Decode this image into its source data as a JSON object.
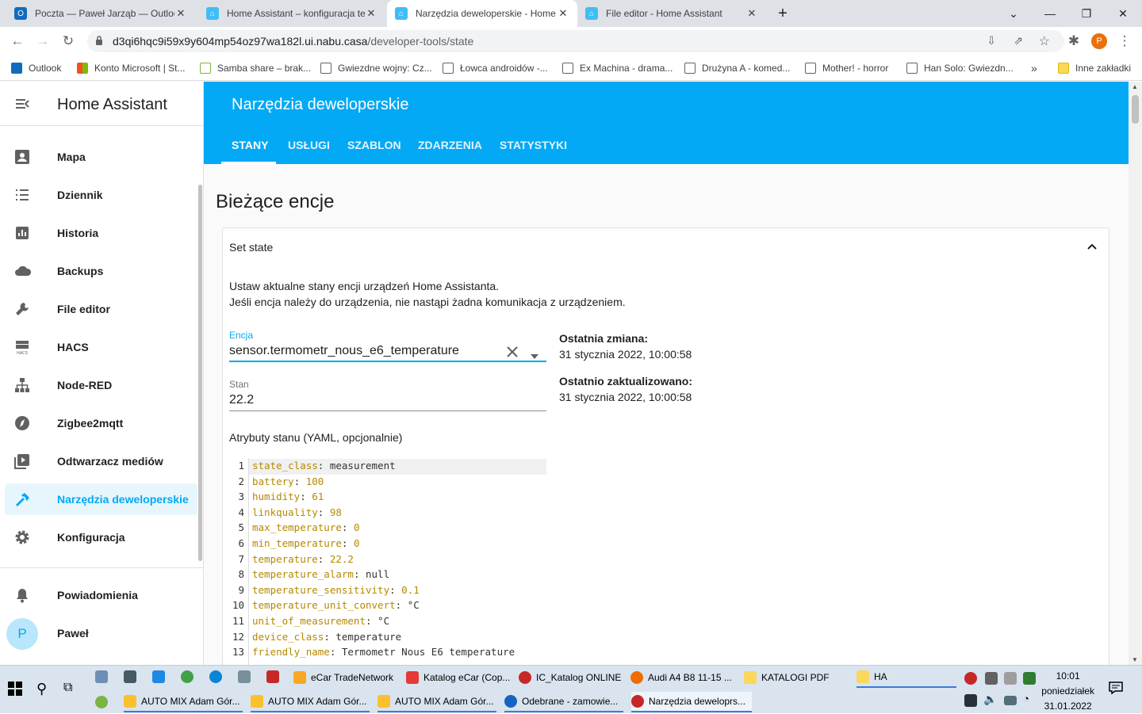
{
  "browser": {
    "tabs": [
      {
        "title": "Poczta — Paweł Jarząb — Outlook",
        "icon": "outlook-icon",
        "color": "#0f6cbd"
      },
      {
        "title": "Home Assistant – konfiguracja te",
        "icon": "home-assistant-icon",
        "color": "#41bdf5"
      },
      {
        "title": "Narzędzia deweloperskie - Home",
        "icon": "home-assistant-icon",
        "color": "#41bdf5"
      },
      {
        "title": "File editor - Home Assistant",
        "icon": "home-assistant-icon",
        "color": "#41bdf5"
      }
    ],
    "active_tab": 2,
    "url_host": "d3qi6hqc9i59x9y604mp54oz97wa182l.ui.nabu.casa",
    "url_path": "/developer-tools/state",
    "profile_initial": "P",
    "bookmarks": [
      "Outlook",
      "Konto Microsoft | St...",
      "Samba share – brak...",
      "Gwiezdne wojny: Cz...",
      "Łowca androidów -...",
      "Ex Machina - drama...",
      "Drużyna A - komed...",
      "Mother! - horror",
      "Han Solo: Gwiezdn..."
    ],
    "bookmarks_more": "»",
    "other_bookmarks": "Inne zakładki"
  },
  "sidebar": {
    "title": "Home Assistant",
    "items": [
      {
        "label": "Mapa",
        "icon": "account-box-icon"
      },
      {
        "label": "Dziennik",
        "icon": "list-icon"
      },
      {
        "label": "Historia",
        "icon": "chart-box-icon"
      },
      {
        "label": "Backups",
        "icon": "cloud-icon"
      },
      {
        "label": "File editor",
        "icon": "wrench-icon"
      },
      {
        "label": "HACS",
        "icon": "hacs-icon"
      },
      {
        "label": "Node-RED",
        "icon": "sitemap-icon"
      },
      {
        "label": "Zigbee2mqtt",
        "icon": "compass-icon"
      },
      {
        "label": "Odtwarzacz mediów",
        "icon": "play-box-icon"
      },
      {
        "label": "Narzędzia deweloperskie",
        "icon": "hammer-icon"
      },
      {
        "label": "Konfiguracja",
        "icon": "cog-icon"
      }
    ],
    "selected": "Narzędzia deweloperskie",
    "notifications_label": "Powiadomienia",
    "user_label": "Paweł",
    "user_initial": "P"
  },
  "header": {
    "title": "Narzędzia deweloperskie",
    "tabs": [
      "STANY",
      "USŁUGI",
      "SZABLON",
      "ZDARZENIA",
      "STATYSTYKI"
    ],
    "active_tab": "STANY",
    "color": "#03a9f4"
  },
  "main": {
    "page_title": "Bieżące encje",
    "card_title": "Set state",
    "description_line1": "Ustaw aktualne stany encji urządzeń Home Assistanta.",
    "description_line2": "Jeśli encja należy do urządzenia, nie nastąpi żadna komunikacja z urządzeniem.",
    "entity_label": "Encja",
    "entity_value": "sensor.termometr_nous_e6_temperature",
    "state_label": "Stan",
    "state_value": "22.2",
    "last_changed_label": "Ostatnia zmiana:",
    "last_changed_value": "31 stycznia 2022, 10:00:58",
    "last_updated_label": "Ostatnio zaktualizowano:",
    "last_updated_value": "31 stycznia 2022, 10:00:58",
    "attributes_label": "Atrybuty stanu (YAML, opcjonalnie)",
    "yaml_lines": [
      {
        "n": "1",
        "key": "state_class",
        "val": "measurement",
        "num": false
      },
      {
        "n": "2",
        "key": "battery",
        "val": "100",
        "num": true
      },
      {
        "n": "3",
        "key": "humidity",
        "val": "61",
        "num": true
      },
      {
        "n": "4",
        "key": "linkquality",
        "val": "98",
        "num": true
      },
      {
        "n": "5",
        "key": "max_temperature",
        "val": "0",
        "num": true
      },
      {
        "n": "6",
        "key": "min_temperature",
        "val": "0",
        "num": true
      },
      {
        "n": "7",
        "key": "temperature",
        "val": "22.2",
        "num": true
      },
      {
        "n": "8",
        "key": "temperature_alarm",
        "val": "null",
        "num": false
      },
      {
        "n": "9",
        "key": "temperature_sensitivity",
        "val": "0.1",
        "num": true
      },
      {
        "n": "10",
        "key": "temperature_unit_convert",
        "val": "°C",
        "num": false
      },
      {
        "n": "11",
        "key": "unit_of_measurement",
        "val": "°C",
        "num": false
      },
      {
        "n": "12",
        "key": "device_class",
        "val": "temperature",
        "num": false
      },
      {
        "n": "13",
        "key": "friendly_name",
        "val": "Termometr Nous E6 temperature",
        "num": false
      }
    ]
  },
  "taskbar": {
    "row1": [
      "eCar TradeNetwork",
      "Katalog eCar (Cop...",
      "IC_Katalog ONLINE",
      "Audi A4 B8 11-15 ...",
      "KATALOGI PDF",
      "HA"
    ],
    "row2": [
      "AUTO MIX Adam Gór...",
      "AUTO MIX Adam Gór...",
      "AUTO MIX Adam Gór...",
      "Odebrane - zamowie...",
      "Narzędzia deweloprs..."
    ],
    "time": "10:01",
    "day": "poniedziałek",
    "date": "31.01.2022"
  }
}
